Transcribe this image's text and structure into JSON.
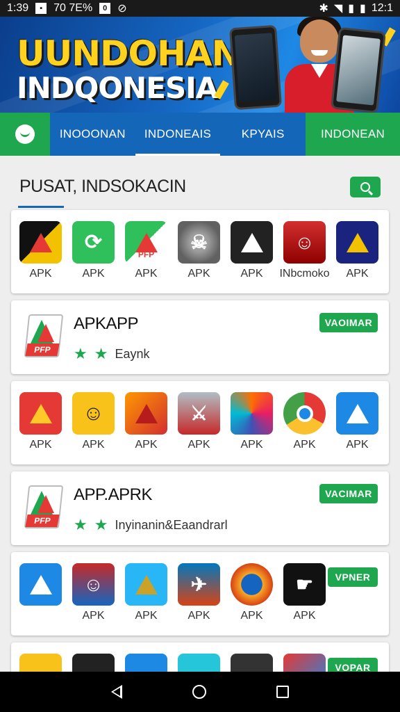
{
  "status_bar": {
    "time": "1:39",
    "mid_text": "70 7E%",
    "box_char": "0",
    "clock_right": "12:1"
  },
  "banner": {
    "line1": "UUNDOHAN",
    "line2": "INDQONESIA",
    "colors": {
      "title_yellow": "#ffd21f",
      "bg_blue": "#1565c0",
      "shirt_red": "#d81e2a"
    }
  },
  "nav": {
    "home_icon": "smile-icon",
    "tabs": [
      {
        "label": "INOOONAN"
      },
      {
        "label": "INDONEAIS",
        "active": true
      },
      {
        "label": "KPYAIS"
      },
      {
        "label": "INDONEAN"
      }
    ]
  },
  "section": {
    "title": "PUSAT, INDSOKACIN",
    "search_icon": "search-icon"
  },
  "row1": [
    {
      "label": "APK",
      "icon": "black-yellow-a-icon"
    },
    {
      "label": "APK",
      "icon": "green-refresh-icon"
    },
    {
      "label": "APK",
      "icon": "pfp-icon"
    },
    {
      "label": "APK",
      "icon": "robot-icon"
    },
    {
      "label": "APK",
      "icon": "black-triangle-icon"
    },
    {
      "label": "INbcmoko",
      "icon": "helmet-person-icon"
    },
    {
      "label": "APK",
      "icon": "navy-yellow-a-icon"
    }
  ],
  "feature1": {
    "title": "APKAPP",
    "rating_text": "Eaynk",
    "button": "VAOIMAR"
  },
  "row2": [
    {
      "label": "APK",
      "icon": "red-a-icon"
    },
    {
      "label": "APK",
      "icon": "police-icon"
    },
    {
      "label": "APK",
      "icon": "fire-triangle-icon"
    },
    {
      "label": "APK",
      "icon": "robot-warrior-icon"
    },
    {
      "label": "APK",
      "icon": "swirl-icon"
    },
    {
      "label": "APK",
      "icon": "chrome-like-icon"
    },
    {
      "label": "APK",
      "icon": "blue-triangle-icon"
    }
  ],
  "feature2": {
    "title": "APP.APRK",
    "rating_text": "Inyinanin&Eaandrarl",
    "button": "VACIMAR"
  },
  "row3": [
    {
      "label": "",
      "icon": "blue-triangle-icon"
    },
    {
      "label": "APK",
      "icon": "soccer-player-icon"
    },
    {
      "label": "APK",
      "icon": "gold-a-icon"
    },
    {
      "label": "APK",
      "icon": "jet-icon"
    },
    {
      "label": "APK",
      "icon": "badge-icon"
    },
    {
      "label": "APK",
      "icon": "hand-icon"
    }
  ],
  "row3_button": "VPNER",
  "row4_button": "VOPAR",
  "system_nav": {
    "back": "back-icon",
    "home": "home-icon",
    "recents": "recents-icon"
  }
}
